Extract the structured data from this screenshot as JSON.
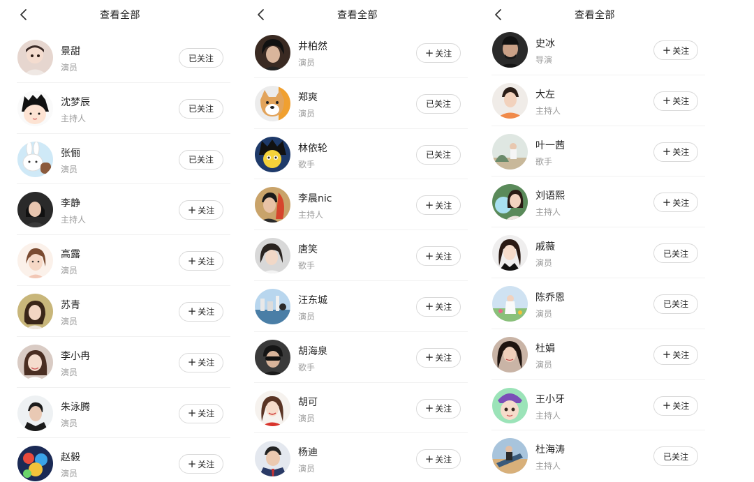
{
  "panels": [
    {
      "title": "查看全部",
      "items": [
        {
          "name": "景甜",
          "role": "演员",
          "button": "已关注",
          "followed": true
        },
        {
          "name": "沈梦辰",
          "role": "主持人",
          "button": "已关注",
          "followed": true
        },
        {
          "name": "张俪",
          "role": "演员",
          "button": "已关注",
          "followed": true
        },
        {
          "name": "李静",
          "role": "主持人",
          "button": "关注",
          "followed": false
        },
        {
          "name": "高露",
          "role": "演员",
          "button": "关注",
          "followed": false
        },
        {
          "name": "苏青",
          "role": "演员",
          "button": "关注",
          "followed": false
        },
        {
          "name": "李小冉",
          "role": "演员",
          "button": "关注",
          "followed": false
        },
        {
          "name": "朱泳腾",
          "role": "演员",
          "button": "关注",
          "followed": false
        },
        {
          "name": "赵毅",
          "role": "演员",
          "button": "关注",
          "followed": false
        }
      ]
    },
    {
      "title": "查看全部",
      "items": [
        {
          "name": "井柏然",
          "role": "演员",
          "button": "关注",
          "followed": false
        },
        {
          "name": "郑爽",
          "role": "演员",
          "button": "已关注",
          "followed": true
        },
        {
          "name": "林依轮",
          "role": "歌手",
          "button": "已关注",
          "followed": true
        },
        {
          "name": "李晨nic",
          "role": "主持人",
          "button": "关注",
          "followed": false
        },
        {
          "name": "唐笑",
          "role": "歌手",
          "button": "关注",
          "followed": false
        },
        {
          "name": "汪东城",
          "role": "演员",
          "button": "关注",
          "followed": false
        },
        {
          "name": "胡海泉",
          "role": "歌手",
          "button": "关注",
          "followed": false
        },
        {
          "name": "胡可",
          "role": "演员",
          "button": "关注",
          "followed": false
        },
        {
          "name": "杨迪",
          "role": "演员",
          "button": "关注",
          "followed": false
        }
      ]
    },
    {
      "title": "查看全部",
      "items": [
        {
          "name": "史冰",
          "role": "导演",
          "button": "关注",
          "followed": false
        },
        {
          "name": "大左",
          "role": "主持人",
          "button": "关注",
          "followed": false
        },
        {
          "name": "叶一茜",
          "role": "歌手",
          "button": "关注",
          "followed": false
        },
        {
          "name": "刘语熙",
          "role": "主持人",
          "button": "关注",
          "followed": false
        },
        {
          "name": "戚薇",
          "role": "演员",
          "button": "已关注",
          "followed": true
        },
        {
          "name": "陈乔恩",
          "role": "演员",
          "button": "已关注",
          "followed": true
        },
        {
          "name": "杜娟",
          "role": "演员",
          "button": "关注",
          "followed": false
        },
        {
          "name": "王小牙",
          "role": "主持人",
          "button": "关注",
          "followed": false
        },
        {
          "name": "杜海涛",
          "role": "主持人",
          "button": "已关注",
          "followed": true
        }
      ]
    }
  ],
  "colors": {
    "text": "#222222",
    "subtext": "#9a9a9a",
    "border": "#d9d9d9",
    "divider": "#f1f1f1"
  }
}
